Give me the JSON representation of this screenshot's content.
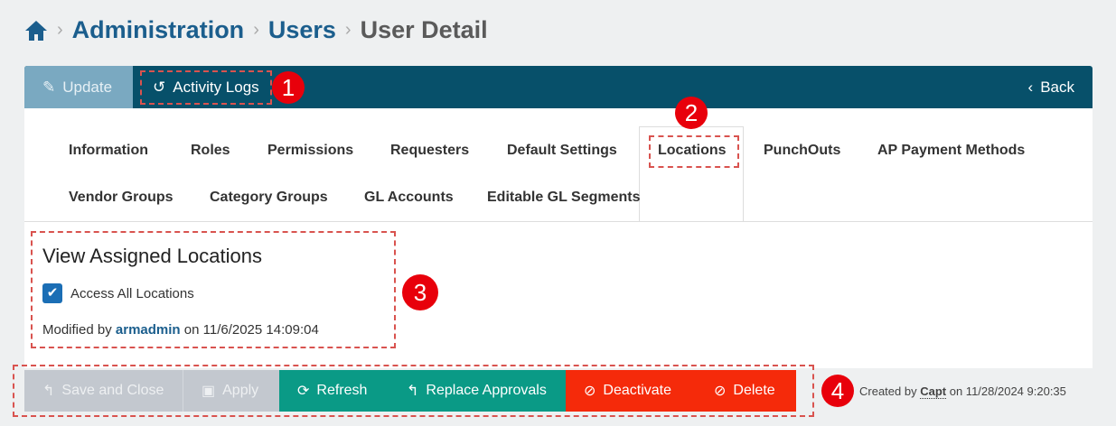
{
  "breadcrumb": {
    "items": [
      "Administration",
      "Users"
    ],
    "current": "User Detail"
  },
  "toolbar": {
    "update": "Update",
    "activity_logs": "Activity Logs",
    "back": "Back"
  },
  "tabs": [
    "Information",
    "Roles",
    "Permissions",
    "Requesters",
    "Default Settings",
    "Locations",
    "PunchOuts",
    "AP Payment Methods",
    "Vendor Groups",
    "Category Groups",
    "GL Accounts",
    "Editable GL Segments"
  ],
  "active_tab": "Locations",
  "section": {
    "title": "View Assigned Locations",
    "checkbox_label": "Access All Locations",
    "checked": true,
    "modified_prefix": "Modified by",
    "modified_user": "armadmin",
    "modified_suffix": "on 11/6/2025 14:09:04"
  },
  "footer": {
    "buttons": [
      "Save and Close",
      "Apply",
      "Refresh",
      "Replace Approvals",
      "Deactivate",
      "Delete"
    ],
    "created_prefix": "Created by",
    "created_user": "Capt",
    "created_suffix": "on 11/28/2024 9:20:35"
  },
  "annotations": [
    "1",
    "2",
    "3",
    "4"
  ],
  "colors": {
    "toolbar": "#07506a",
    "teal": "#0a9a86",
    "red": "#f52a0a",
    "link": "#1b5e8d"
  }
}
